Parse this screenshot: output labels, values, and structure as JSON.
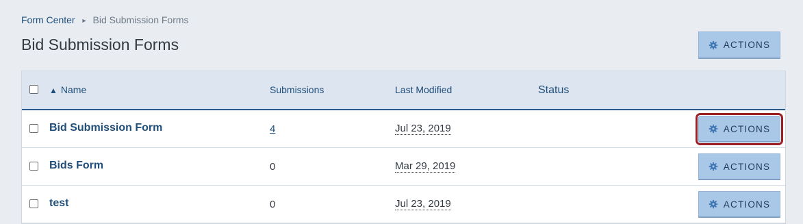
{
  "breadcrumb": {
    "root": "Form Center",
    "separator": "►",
    "current": "Bid Submission Forms"
  },
  "page_title": "Bid Submission Forms",
  "top_actions_label": "ACTIONS",
  "table": {
    "headers": {
      "sort_indicator": "▲",
      "name": "Name",
      "submissions": "Submissions",
      "last_modified": "Last Modified",
      "status": "Status"
    },
    "rows": [
      {
        "name": "Bid Submission Form",
        "submissions": "4",
        "submissions_linked": true,
        "last_modified": "Jul 23, 2019",
        "status": "",
        "actions_label": "ACTIONS",
        "highlighted": true
      },
      {
        "name": "Bids Form",
        "submissions": "0",
        "submissions_linked": false,
        "last_modified": "Mar 29, 2019",
        "status": "",
        "actions_label": "ACTIONS",
        "highlighted": false
      },
      {
        "name": "test",
        "submissions": "0",
        "submissions_linked": false,
        "last_modified": "Jul 23, 2019",
        "status": "",
        "actions_label": "ACTIONS",
        "highlighted": false
      }
    ]
  },
  "colors": {
    "accent": "#1f4f7a",
    "button_bg": "#a9c7e6",
    "highlight": "#9c1f24"
  },
  "icons": {
    "actions": "gear-icon"
  }
}
